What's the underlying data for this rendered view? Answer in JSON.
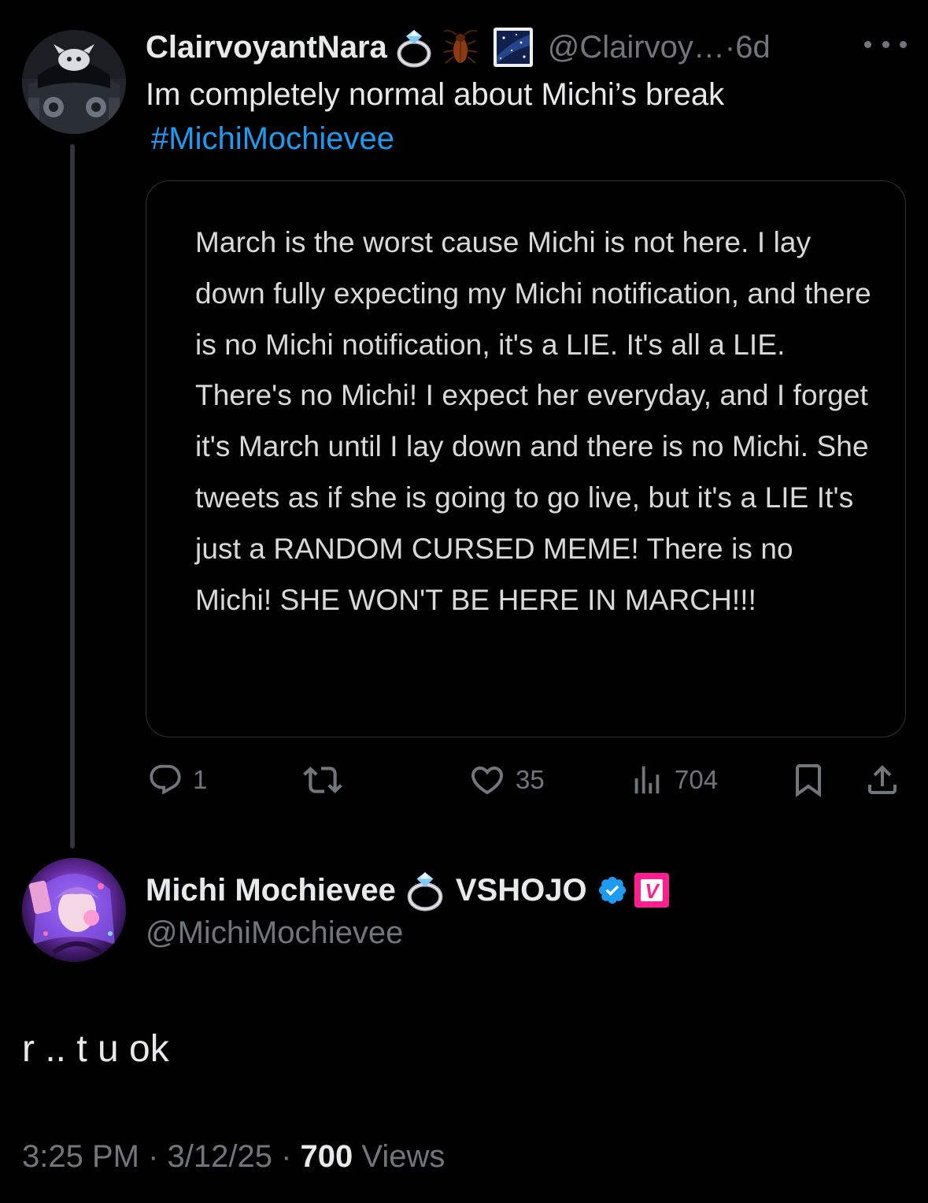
{
  "tweet": {
    "author_name": "ClairvoyantNara",
    "author_handle": "@Clairvoy…",
    "separator": " · ",
    "time_ago": "6d",
    "text": "Im completely normal about Michi’s break",
    "hashtag": "#MichiMochievee",
    "quote_text": "March is the worst cause Michi is not here. I lay down fully expecting my Michi notification, and there is no Michi notification, it's a LIE. It's all a LIE. There's no Michi! I expect her everyday, and I forget it's March until I lay down and there is no Michi. She tweets as if she is going to go live, but it's a LIE It's just a RANDOM CURSED MEME! There is no Michi! SHE WON'T BE HERE IN MARCH!!!",
    "name_icons": [
      "ring-emoji",
      "cockroach-emoji",
      "starry-night-emoji"
    ],
    "counts": {
      "replies": "1",
      "likes": "35",
      "views": "704"
    }
  },
  "reply": {
    "author_name": "Michi Mochievee",
    "author_affiliation": "VSHOJO",
    "author_handle": "@MichiMochievee",
    "name_icons": [
      "ring-emoji",
      "verified-badge",
      "vshojo-badge"
    ],
    "badge_letter": "V",
    "text": "r .. t u ok",
    "time": "3:25 PM",
    "date": "3/12/25",
    "dot": " · ",
    "views_count": "700",
    "views_label": "Views"
  },
  "colors": {
    "background": "#000000",
    "primary_text": "#e7e9ea",
    "secondary_text": "#71767b",
    "link": "#1d9bf0",
    "verified": "#1d9bf0",
    "vshojo_pink": "#ff1f8e",
    "border": "#2f3336"
  }
}
